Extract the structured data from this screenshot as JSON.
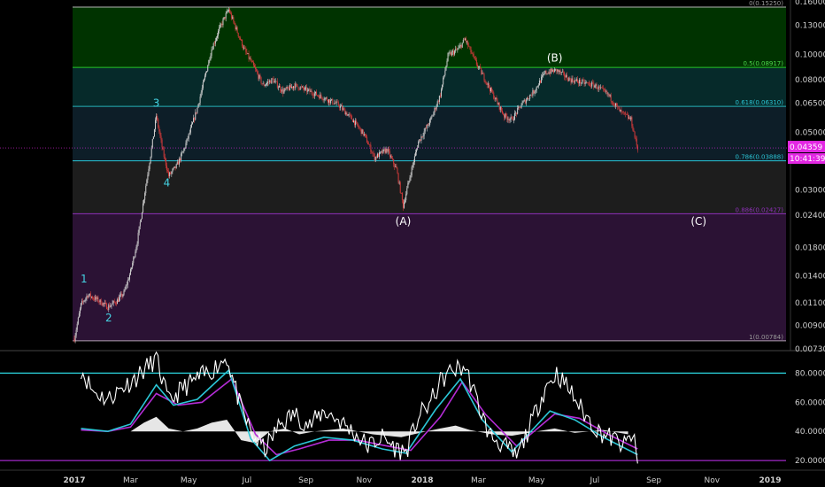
{
  "chart_data": {
    "type": "candlestick",
    "price_scale": "log",
    "ylim": [
      0.0073,
      0.165
    ],
    "y_tick_labels": [
      "0.16000",
      "0.13000",
      "0.10000",
      "0.08000",
      "0.06500",
      "0.05000",
      "0.03900",
      "0.03000",
      "0.02400",
      "0.01800",
      "0.01400",
      "0.01100",
      "0.00900",
      "0.00730"
    ],
    "x_tick_labels": [
      {
        "label": "2017",
        "date": "2017-01-01",
        "bold": true
      },
      {
        "label": "Mar",
        "date": "2017-03-01"
      },
      {
        "label": "May",
        "date": "2017-05-01"
      },
      {
        "label": "Jul",
        "date": "2017-07-01"
      },
      {
        "label": "Sep",
        "date": "2017-09-01"
      },
      {
        "label": "Nov",
        "date": "2017-11-01"
      },
      {
        "label": "2018",
        "date": "2018-01-01",
        "bold": true
      },
      {
        "label": "Mar",
        "date": "2018-03-01"
      },
      {
        "label": "May",
        "date": "2018-05-01"
      },
      {
        "label": "Jul",
        "date": "2018-07-01"
      },
      {
        "label": "Sep",
        "date": "2018-09-01"
      },
      {
        "label": "Nov",
        "date": "2018-11-01"
      },
      {
        "label": "2019",
        "date": "2019-01-01",
        "bold": true
      }
    ],
    "price_path": [
      [
        "2017-01-01",
        0.008
      ],
      [
        "2017-01-08",
        0.0108
      ],
      [
        "2017-01-15",
        0.0118
      ],
      [
        "2017-01-25",
        0.0113
      ],
      [
        "2017-02-05",
        0.0106
      ],
      [
        "2017-02-15",
        0.0112
      ],
      [
        "2017-02-22",
        0.012
      ],
      [
        "2017-03-01",
        0.0145
      ],
      [
        "2017-03-08",
        0.019
      ],
      [
        "2017-03-15",
        0.028
      ],
      [
        "2017-03-22",
        0.041
      ],
      [
        "2017-03-28",
        0.058
      ],
      [
        "2017-04-04",
        0.042
      ],
      [
        "2017-04-10",
        0.034
      ],
      [
        "2017-04-18",
        0.037
      ],
      [
        "2017-04-25",
        0.042
      ],
      [
        "2017-05-02",
        0.05
      ],
      [
        "2017-05-10",
        0.062
      ],
      [
        "2017-05-18",
        0.082
      ],
      [
        "2017-05-25",
        0.105
      ],
      [
        "2017-06-02",
        0.125
      ],
      [
        "2017-06-08",
        0.14
      ],
      [
        "2017-06-12",
        0.149
      ],
      [
        "2017-06-20",
        0.125
      ],
      [
        "2017-06-28",
        0.105
      ],
      [
        "2017-07-08",
        0.09
      ],
      [
        "2017-07-18",
        0.076
      ],
      [
        "2017-07-28",
        0.08
      ],
      [
        "2017-08-08",
        0.072
      ],
      [
        "2017-08-20",
        0.076
      ],
      [
        "2017-09-05",
        0.072
      ],
      [
        "2017-09-20",
        0.068
      ],
      [
        "2017-10-05",
        0.064
      ],
      [
        "2017-10-20",
        0.056
      ],
      [
        "2017-11-01",
        0.049
      ],
      [
        "2017-11-12",
        0.04
      ],
      [
        "2017-11-25",
        0.043
      ],
      [
        "2017-12-05",
        0.036
      ],
      [
        "2017-12-12",
        0.026
      ],
      [
        "2017-12-20",
        0.035
      ],
      [
        "2017-12-28",
        0.046
      ],
      [
        "2018-01-10",
        0.056
      ],
      [
        "2018-01-20",
        0.07
      ],
      [
        "2018-01-28",
        0.099
      ],
      [
        "2018-02-08",
        0.105
      ],
      [
        "2018-02-15",
        0.115
      ],
      [
        "2018-02-25",
        0.095
      ],
      [
        "2018-03-08",
        0.08
      ],
      [
        "2018-03-18",
        0.068
      ],
      [
        "2018-03-28",
        0.058
      ],
      [
        "2018-04-05",
        0.056
      ],
      [
        "2018-04-15",
        0.064
      ],
      [
        "2018-04-28",
        0.072
      ],
      [
        "2018-05-10",
        0.085
      ],
      [
        "2018-05-22",
        0.087
      ],
      [
        "2018-06-05",
        0.08
      ],
      [
        "2018-06-18",
        0.078
      ],
      [
        "2018-07-01",
        0.076
      ],
      [
        "2018-07-15",
        0.07
      ],
      [
        "2018-07-28",
        0.06
      ],
      [
        "2018-08-08",
        0.056
      ],
      [
        "2018-08-15",
        0.043
      ]
    ],
    "fib_levels": [
      {
        "label": "0(0.15250)",
        "price": 0.1525,
        "fill": "#003300",
        "line": "#b5b5b5",
        "text_color": "#9a9a9a"
      },
      {
        "label": "0.5(0.08917)",
        "price": 0.08917,
        "fill": "#062a2a",
        "line": "#26c626",
        "text_color": "#4bd84b"
      },
      {
        "label": "0.618(0.06310)",
        "price": 0.0631,
        "fill": "#0d1e28",
        "line": "#27b2b7",
        "text_color": "#2bc3d3"
      },
      {
        "label": "0.786(0.03888)",
        "price": 0.03888,
        "fill": "#1d1d1d",
        "line": "#29c6d6",
        "text_color": "#2bc3d3"
      },
      {
        "label": "0.886(0.02427)",
        "price": 0.02427,
        "fill": "#2b1234",
        "line": "#8e30b8",
        "text_color": "#8e30b8"
      },
      {
        "label": "1(0.00784)",
        "price": 0.00784,
        "fill": "",
        "line": "#b0a0b0",
        "text_color": "#9a9a9a"
      }
    ],
    "wave_labels": [
      {
        "label": "1",
        "date": "2017-01-11",
        "price": 0.0132,
        "color": "#45d3e3"
      },
      {
        "label": "2",
        "date": "2017-02-06",
        "price": 0.0093,
        "color": "#45d3e3"
      },
      {
        "label": "3",
        "date": "2017-03-28",
        "price": 0.063,
        "color": "#45d3e3"
      },
      {
        "label": "4",
        "date": "2017-04-08",
        "price": 0.031,
        "color": "#45d3e3"
      },
      {
        "label": "5",
        "date": "2017-06-10",
        "price": 0.165,
        "color": "#45d3e3"
      },
      {
        "label": "(A)",
        "date": "2017-12-12",
        "price": 0.022,
        "color": "#ffffff"
      },
      {
        "label": "(B)",
        "date": "2018-05-20",
        "price": 0.094,
        "color": "#ffffff"
      },
      {
        "label": "(C)",
        "date": "2018-10-18",
        "price": 0.022,
        "color": "#ffffff"
      }
    ],
    "last_price": {
      "label": "0.04359",
      "price": 0.04359,
      "countdown": "10:41:39",
      "color": "#e327e3"
    },
    "oscillator": {
      "y_tick_labels": [
        "80.0000",
        "60.0000",
        "40.0000",
        "20.0000"
      ],
      "ylim": [
        14,
        93
      ],
      "levels": [
        {
          "value": 80,
          "color": "#2bd6e0"
        },
        {
          "value": 20,
          "color": "#a128c8"
        }
      ],
      "series_colors": {
        "main": "#ffffff",
        "signal1": "#2bc6d6",
        "signal2": "#b42cd6",
        "histogram": "#ffffff"
      },
      "main": [
        [
          "2017-01-08",
          83
        ],
        [
          "2017-01-20",
          68
        ],
        [
          "2017-02-05",
          62
        ],
        [
          "2017-02-20",
          70
        ],
        [
          "2017-03-05",
          76
        ],
        [
          "2017-03-20",
          85
        ],
        [
          "2017-03-28",
          90
        ],
        [
          "2017-04-10",
          60
        ],
        [
          "2017-04-25",
          70
        ],
        [
          "2017-05-10",
          76
        ],
        [
          "2017-05-25",
          82
        ],
        [
          "2017-06-10",
          91
        ],
        [
          "2017-06-25",
          55
        ],
        [
          "2017-07-08",
          36
        ],
        [
          "2017-07-20",
          28
        ],
        [
          "2017-08-05",
          45
        ],
        [
          "2017-08-20",
          52
        ],
        [
          "2017-09-05",
          44
        ],
        [
          "2017-09-20",
          54
        ],
        [
          "2017-10-05",
          48
        ],
        [
          "2017-10-20",
          40
        ],
        [
          "2017-11-05",
          30
        ],
        [
          "2017-11-20",
          36
        ],
        [
          "2017-12-05",
          28
        ],
        [
          "2017-12-15",
          26
        ],
        [
          "2017-12-28",
          50
        ],
        [
          "2018-01-10",
          60
        ],
        [
          "2018-01-20",
          74
        ],
        [
          "2018-02-01",
          82
        ],
        [
          "2018-02-15",
          84
        ],
        [
          "2018-02-28",
          60
        ],
        [
          "2018-03-12",
          38
        ],
        [
          "2018-03-28",
          30
        ],
        [
          "2018-04-10",
          22
        ],
        [
          "2018-04-25",
          45
        ],
        [
          "2018-05-10",
          70
        ],
        [
          "2018-05-22",
          80
        ],
        [
          "2018-06-05",
          68
        ],
        [
          "2018-06-20",
          52
        ],
        [
          "2018-07-05",
          40
        ],
        [
          "2018-07-20",
          35
        ],
        [
          "2018-08-01",
          30
        ],
        [
          "2018-08-10",
          38
        ],
        [
          "2018-08-15",
          18
        ]
      ],
      "signal1": [
        [
          "2017-01-08",
          42
        ],
        [
          "2017-02-05",
          40
        ],
        [
          "2017-03-01",
          45
        ],
        [
          "2017-03-28",
          72
        ],
        [
          "2017-04-15",
          58
        ],
        [
          "2017-05-10",
          62
        ],
        [
          "2017-06-12",
          82
        ],
        [
          "2017-07-05",
          35
        ],
        [
          "2017-07-25",
          20
        ],
        [
          "2017-08-20",
          30
        ],
        [
          "2017-09-20",
          36
        ],
        [
          "2017-10-20",
          34
        ],
        [
          "2017-11-20",
          28
        ],
        [
          "2017-12-15",
          25
        ],
        [
          "2018-01-15",
          55
        ],
        [
          "2018-02-10",
          76
        ],
        [
          "2018-03-05",
          48
        ],
        [
          "2018-04-05",
          26
        ],
        [
          "2018-05-15",
          54
        ],
        [
          "2018-06-10",
          48
        ],
        [
          "2018-07-10",
          36
        ],
        [
          "2018-08-15",
          24
        ]
      ],
      "signal2": [
        [
          "2017-01-08",
          41
        ],
        [
          "2017-02-05",
          40
        ],
        [
          "2017-03-01",
          43
        ],
        [
          "2017-03-28",
          66
        ],
        [
          "2017-04-20",
          58
        ],
        [
          "2017-05-15",
          60
        ],
        [
          "2017-06-15",
          76
        ],
        [
          "2017-07-10",
          38
        ],
        [
          "2017-08-01",
          24
        ],
        [
          "2017-08-25",
          28
        ],
        [
          "2017-09-25",
          34
        ],
        [
          "2017-10-25",
          34
        ],
        [
          "2017-11-25",
          30
        ],
        [
          "2017-12-20",
          27
        ],
        [
          "2018-01-20",
          50
        ],
        [
          "2018-02-12",
          74
        ],
        [
          "2018-03-08",
          52
        ],
        [
          "2018-04-10",
          30
        ],
        [
          "2018-05-20",
          52
        ],
        [
          "2018-06-15",
          49
        ],
        [
          "2018-07-15",
          38
        ],
        [
          "2018-08-15",
          28
        ]
      ],
      "histogram": [
        [
          "2017-03-01",
          40
        ],
        [
          "2017-03-15",
          46
        ],
        [
          "2017-03-28",
          50
        ],
        [
          "2017-04-10",
          42
        ],
        [
          "2017-04-25",
          40
        ],
        [
          "2017-05-10",
          42
        ],
        [
          "2017-05-25",
          46
        ],
        [
          "2017-06-10",
          48
        ],
        [
          "2017-06-25",
          34
        ],
        [
          "2017-07-10",
          32
        ],
        [
          "2017-07-25",
          40
        ],
        [
          "2017-08-10",
          42
        ],
        [
          "2017-08-25",
          38
        ],
        [
          "2017-09-10",
          40
        ],
        [
          "2017-10-10",
          42
        ],
        [
          "2017-11-10",
          38
        ],
        [
          "2017-12-10",
          36
        ],
        [
          "2018-01-05",
          40
        ],
        [
          "2018-01-20",
          42
        ],
        [
          "2018-02-05",
          44
        ],
        [
          "2018-02-20",
          41
        ],
        [
          "2018-03-15",
          38
        ],
        [
          "2018-04-05",
          37
        ],
        [
          "2018-05-01",
          40
        ],
        [
          "2018-05-20",
          42
        ],
        [
          "2018-06-10",
          39
        ],
        [
          "2018-07-10",
          41
        ],
        [
          "2018-08-05",
          38
        ]
      ]
    }
  }
}
